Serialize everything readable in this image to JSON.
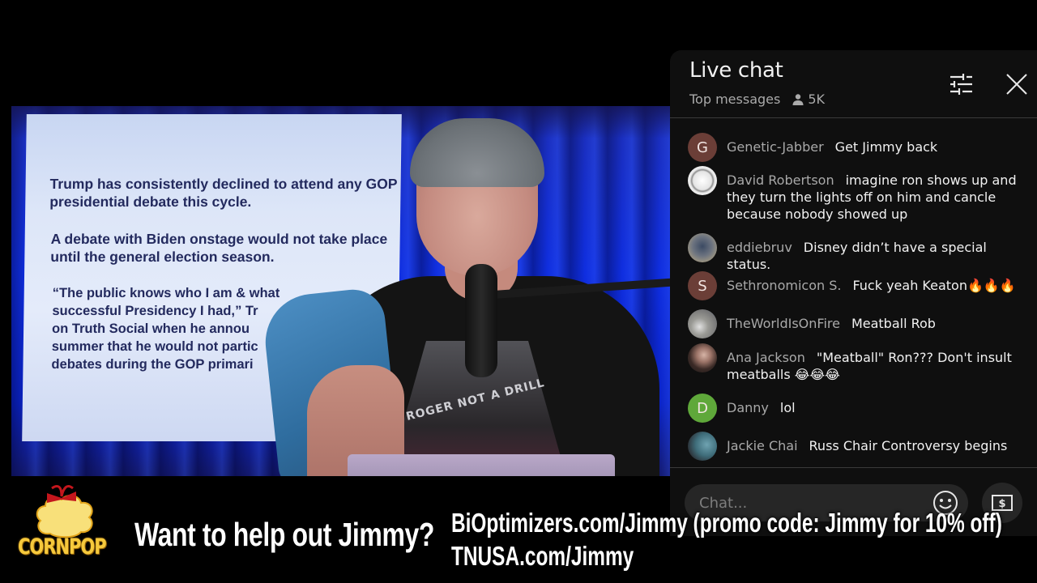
{
  "video": {
    "slide": {
      "paragraph_1": "Trump has consistently declined to attend any GOP presidential debate this cycle.",
      "paragraph_2": "A debate with Biden onstage would not take place until the general election season.",
      "paragraph_3_lines": [
        "“The public knows who I am & what",
        "successful Presidency I had,” Tr",
        "on Truth Social when he annou",
        "summer that he would not partic",
        "debates during the GOP primari"
      ]
    },
    "shirt_text": "ROGER NOT A DRILL"
  },
  "chat": {
    "title": "Live chat",
    "mode": "Top messages",
    "viewer_count": "5K",
    "icons": {
      "viewers": "person-icon",
      "filter": "sliders-icon",
      "close": "close-icon",
      "emoji": "smiley-icon",
      "super_chat": "dollar-bill-icon"
    },
    "messages": [
      {
        "author": "Genetic-Jabber",
        "text": "Get Jimmy back",
        "avatar_letter": "G",
        "avatar_color": "#6b3e37"
      },
      {
        "author": "David Robertson",
        "text": "imagine ron shows up and they turn the lights off on him and cancle because nobody showed up",
        "avatar_letter": "",
        "avatar_color": "#e8e8e8"
      },
      {
        "author": "eddiebruv",
        "text": "Disney didn’t have a special status.",
        "avatar_letter": "",
        "avatar_color": "#5d6470"
      },
      {
        "author": "Sethronomicon S.",
        "text": "Fuck yeah Keaton🔥🔥🔥",
        "avatar_letter": "S",
        "avatar_color": "#6b3e37"
      },
      {
        "author": "TheWorldIsOnFire",
        "text": "Meatball Rob",
        "avatar_letter": "",
        "avatar_color": "#8a8a86"
      },
      {
        "author": "Ana Jackson",
        "text": "\"Meatball\" Ron??? Don't insult meatballs 😂😂😂",
        "avatar_letter": "",
        "avatar_color": "#3a2a26"
      },
      {
        "author": "Danny",
        "text": "lol",
        "avatar_letter": "D",
        "avatar_color": "#5fa83a"
      },
      {
        "author": "Jackie Chai",
        "text": "Russ Chair Controversy begins",
        "avatar_letter": "",
        "avatar_color": "#3f6d7a"
      }
    ],
    "input_placeholder": "Chat..."
  },
  "banner": {
    "logo_text": "CORNPOP",
    "headline": "Want to help out Jimmy?",
    "line_1": "BiOptimizers.com/Jimmy (promo code: Jimmy for 10% off)",
    "line_2": "TNUSA.com/Jimmy"
  }
}
